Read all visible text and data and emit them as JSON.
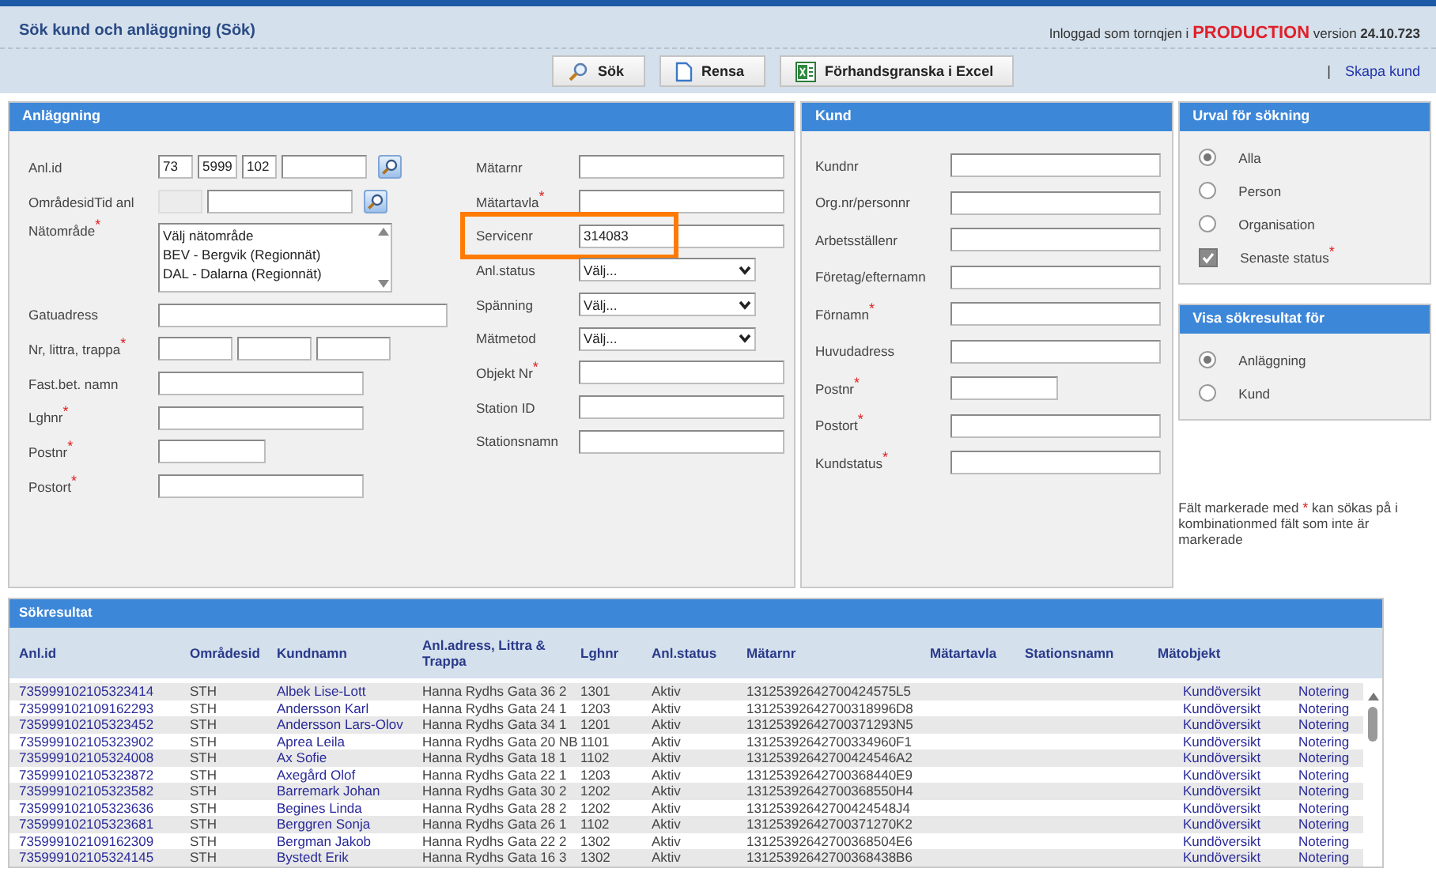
{
  "header": {
    "title": "Sök kund och anläggning (Sök)",
    "login_text": "Inloggad som tornqjen i",
    "environment": "PRODUCTION",
    "version_label": "version",
    "version": "24.10.723"
  },
  "toolbar": {
    "buttons": [
      {
        "label": "Sök"
      },
      {
        "label": "Rensa"
      },
      {
        "label": "Förhandsgranska i Excel"
      }
    ],
    "separator": "|",
    "link": "Skapa kund"
  },
  "installation": {
    "title": "Anläggning",
    "left_fields": [
      {
        "label": "Anl.id",
        "kind": "lookup",
        "values": [
          "73",
          "5999",
          "102"
        ]
      },
      {
        "label": "OmrådesidTid anl",
        "kind": "area-lookup"
      },
      {
        "label": "Nätområde",
        "mark": "*",
        "kind": "listbox",
        "options": [
          "Välj nätområde",
          "BEV - Bergvik (Regionnät)",
          "DAL - Dalarna (Regionnät)"
        ]
      },
      {
        "label": "Gatuadress",
        "kind": "wide-text"
      },
      {
        "label": "Nr, littra, trappa",
        "mark": "*",
        "kind": "triple"
      },
      {
        "label": "Fast.bet. namn",
        "kind": "text"
      },
      {
        "label": "Lghnr",
        "mark": "*",
        "kind": "text"
      },
      {
        "label": "Postnr",
        "mark": "*",
        "kind": "short-text"
      },
      {
        "label": "Postort",
        "mark": "*",
        "kind": "text"
      }
    ],
    "right_fields": [
      {
        "label": "Mätarnr",
        "kind": "text"
      },
      {
        "label": "Mätartavla",
        "mark": "*",
        "kind": "text"
      },
      {
        "label": "Servicenr",
        "kind": "text",
        "value": "314083",
        "highlighted": true
      },
      {
        "label": "Anl.status",
        "kind": "select",
        "value": "Välj..."
      },
      {
        "label": "Spänning",
        "kind": "select",
        "value": "Välj..."
      },
      {
        "label": "Mätmetod",
        "kind": "select",
        "value": "Välj..."
      },
      {
        "label": "Objekt Nr",
        "mark": "*",
        "kind": "text"
      },
      {
        "label": "Station ID",
        "kind": "text"
      },
      {
        "label": "Stationsnamn",
        "kind": "text"
      }
    ]
  },
  "customer": {
    "title": "Kund",
    "fields": [
      {
        "label": "Kundnr",
        "kind": "text"
      },
      {
        "label": "Org.nr/personnr",
        "kind": "text"
      },
      {
        "label": "Arbetsställenr",
        "kind": "text"
      },
      {
        "label": "Företag/efternamn",
        "kind": "text"
      },
      {
        "label": "Förnamn",
        "mark": "*",
        "kind": "text"
      },
      {
        "label": "Huvudadress",
        "kind": "text"
      },
      {
        "label": "Postnr",
        "mark": "*",
        "kind": "short-text"
      },
      {
        "label": "Postort",
        "mark": "*",
        "kind": "text"
      },
      {
        "label": "Kundstatus",
        "mark": "*",
        "kind": "text"
      }
    ]
  },
  "search_scope": {
    "title": "Urval för sökning",
    "options": [
      {
        "label": "Alla",
        "kind": "radio",
        "selected": true
      },
      {
        "label": "Person",
        "kind": "radio",
        "selected": false
      },
      {
        "label": "Organisation",
        "kind": "radio",
        "selected": false
      },
      {
        "label": "Senaste status",
        "mark": "*",
        "kind": "checkbox",
        "selected": true
      }
    ]
  },
  "show_results_for": {
    "title": "Visa sökresultat för",
    "options": [
      {
        "label": "Anläggning",
        "selected": true
      },
      {
        "label": "Kund",
        "selected": false
      }
    ]
  },
  "note": {
    "before": "Fält markerade med",
    "mark": "*",
    "after": "kan sökas på i kombinationmed fält som inte är markerade"
  },
  "results": {
    "title": "Sökresultat",
    "columns": [
      "Anl.id",
      "Områdesid",
      "Kundnamn",
      "Anl.adress, Littra & Trappa",
      "Lghnr",
      "Anl.status",
      "Mätarnr",
      "Mätartavla",
      "Stationsnamn",
      "Mätobjekt"
    ],
    "rows": [
      {
        "anl_id": "735999102105323414",
        "area_id": "STH",
        "customer_name": "Albek Lise-Lott",
        "address": "Hanna Rydhs Gata 36 2",
        "lghnr": "1301",
        "status": "Aktiv",
        "meter_no": "13125392642700424575L5",
        "overview_link": "Kundöversikt",
        "note_link": "Notering"
      },
      {
        "anl_id": "735999102109162293",
        "area_id": "STH",
        "customer_name": "Andersson Karl",
        "address": "Hanna Rydhs Gata 24 1",
        "lghnr": "1203",
        "status": "Aktiv",
        "meter_no": "13125392642700318996D8",
        "overview_link": "Kundöversikt",
        "note_link": "Notering"
      },
      {
        "anl_id": "735999102105323452",
        "area_id": "STH",
        "customer_name": "Andersson Lars-Olov",
        "address": "Hanna Rydhs Gata 34 1",
        "lghnr": "1201",
        "status": "Aktiv",
        "meter_no": "13125392642700371293N5",
        "overview_link": "Kundöversikt",
        "note_link": "Notering"
      },
      {
        "anl_id": "735999102105323902",
        "area_id": "STH",
        "customer_name": "Aprea Leila",
        "address": "Hanna Rydhs Gata 20 NB",
        "lghnr": "1101",
        "status": "Aktiv",
        "meter_no": "13125392642700334960F1",
        "overview_link": "Kundöversikt",
        "note_link": "Notering"
      },
      {
        "anl_id": "735999102105324008",
        "area_id": "STH",
        "customer_name": "Ax Sofie",
        "address": "Hanna Rydhs Gata 18 1",
        "lghnr": "1102",
        "status": "Aktiv",
        "meter_no": "13125392642700424546A2",
        "overview_link": "Kundöversikt",
        "note_link": "Notering"
      },
      {
        "anl_id": "735999102105323872",
        "area_id": "STH",
        "customer_name": "Axegård Olof",
        "address": "Hanna Rydhs Gata 22 1",
        "lghnr": "1203",
        "status": "Aktiv",
        "meter_no": "13125392642700368440E9",
        "overview_link": "Kundöversikt",
        "note_link": "Notering"
      },
      {
        "anl_id": "735999102105323582",
        "area_id": "STH",
        "customer_name": "Barremark Johan",
        "address": "Hanna Rydhs Gata 30 2",
        "lghnr": "1202",
        "status": "Aktiv",
        "meter_no": "13125392642700368550H4",
        "overview_link": "Kundöversikt",
        "note_link": "Notering"
      },
      {
        "anl_id": "735999102105323636",
        "area_id": "STH",
        "customer_name": "Begines Linda",
        "address": "Hanna Rydhs Gata 28 2",
        "lghnr": "1202",
        "status": "Aktiv",
        "meter_no": "13125392642700424548J4",
        "overview_link": "Kundöversikt",
        "note_link": "Notering"
      },
      {
        "anl_id": "735999102105323681",
        "area_id": "STH",
        "customer_name": "Berggren Sonja",
        "address": "Hanna Rydhs Gata 26 1",
        "lghnr": "1102",
        "status": "Aktiv",
        "meter_no": "13125392642700371270K2",
        "overview_link": "Kundöversikt",
        "note_link": "Notering"
      },
      {
        "anl_id": "735999102109162309",
        "area_id": "STH",
        "customer_name": "Bergman Jakob",
        "address": "Hanna Rydhs Gata 22 2",
        "lghnr": "1302",
        "status": "Aktiv",
        "meter_no": "13125392642700368504E6",
        "overview_link": "Kundöversikt",
        "note_link": "Notering"
      },
      {
        "anl_id": "735999102105324145",
        "area_id": "STH",
        "customer_name": "Bystedt Erik",
        "address": "Hanna Rydhs Gata 16 3",
        "lghnr": "1302",
        "status": "Aktiv",
        "meter_no": "13125392642700368438B6",
        "overview_link": "Kundöversikt",
        "note_link": "Notering"
      }
    ]
  }
}
